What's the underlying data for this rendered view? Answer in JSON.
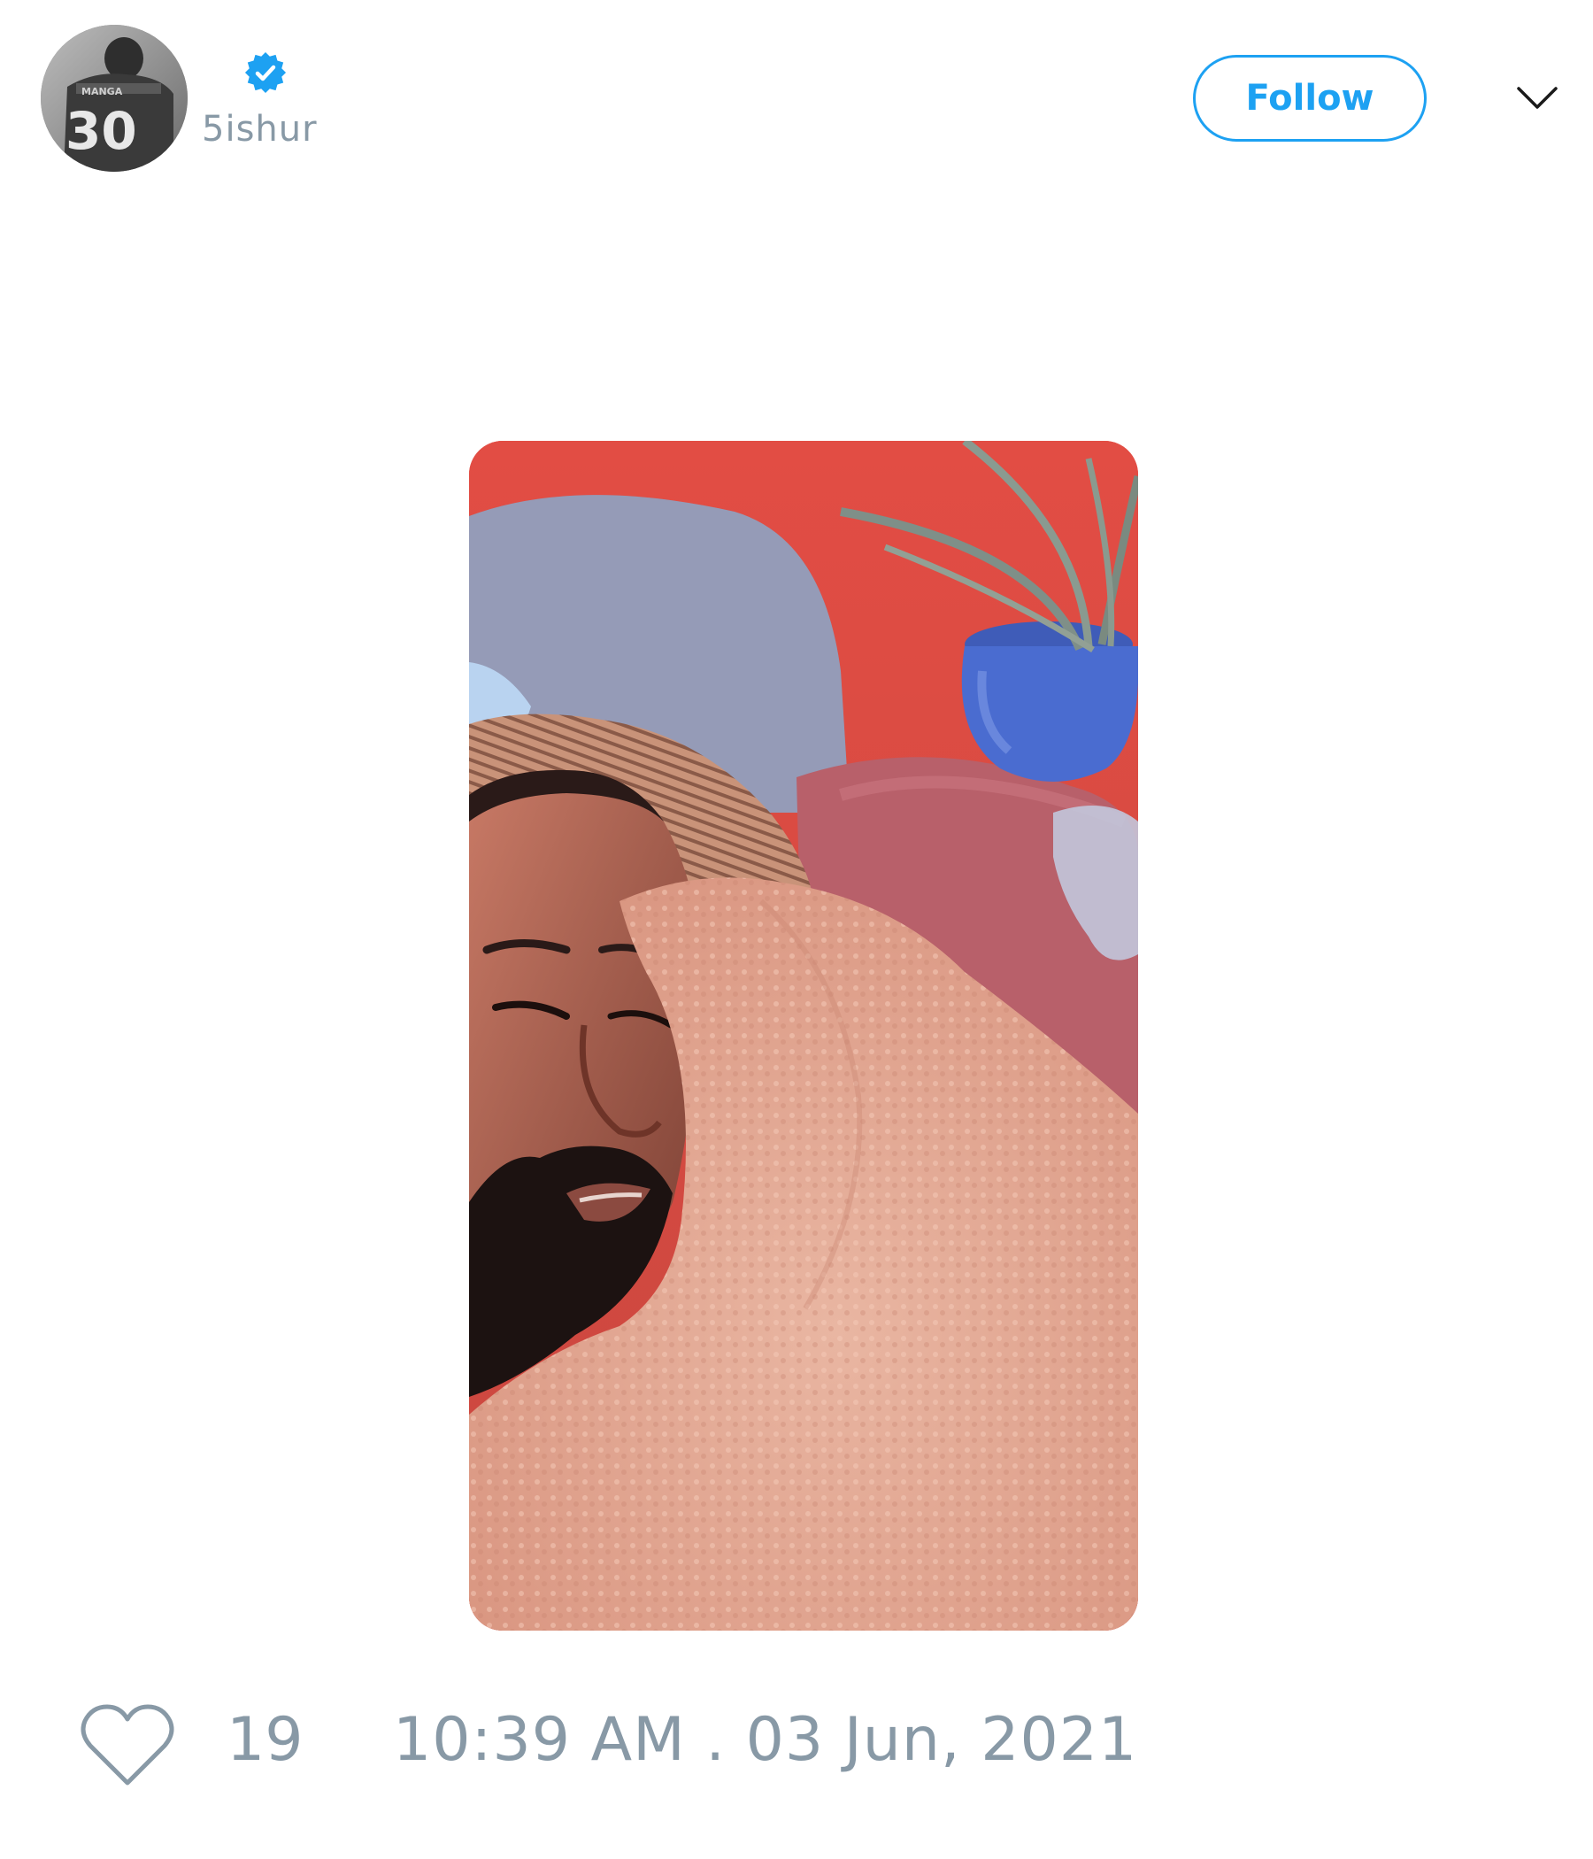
{
  "tweet": {
    "author": {
      "handle": "5ishur",
      "verified": true,
      "avatar_icon": "avatar-jersey-30-image"
    },
    "follow_label": "Follow",
    "menu_icon": "chevron-down-icon",
    "media": {
      "kind": "photo"
    },
    "likes": "19",
    "like_icon": "heart-outline-icon",
    "timestamp": "10:39 AM . 03 Jun, 2021"
  },
  "colors": {
    "accent": "#1da1f2",
    "muted_text": "#8899a6",
    "background": "#ffffff"
  }
}
